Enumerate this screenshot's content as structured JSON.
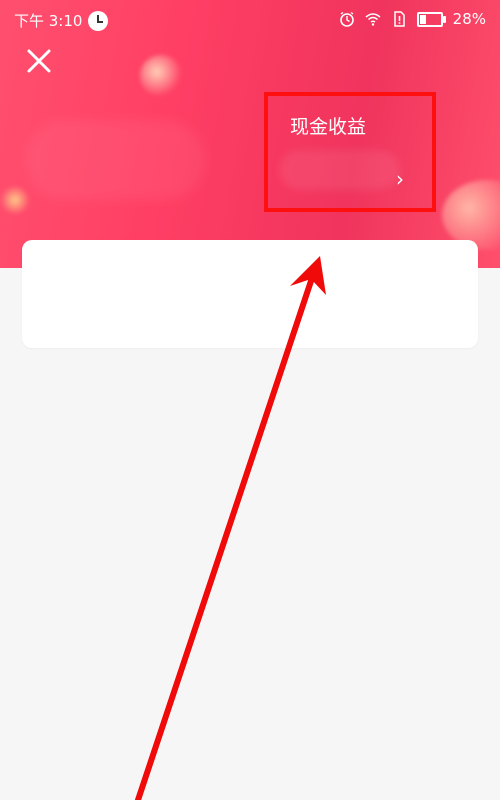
{
  "status_bar": {
    "time": "下午 3:10",
    "battery_percent": "28%",
    "battery_level": 0.28
  },
  "header": {
    "close_icon": "close-icon"
  },
  "earnings": {
    "label": "现金收益",
    "chevron": "›"
  },
  "colors": {
    "hero_gradient_start": "#ff4f6f",
    "hero_gradient_end": "#f0345d",
    "highlight": "#ff1010",
    "background": "#f6f6f6"
  },
  "icons": [
    "clock-icon",
    "alarm-icon",
    "wifi-icon",
    "sim-alert-icon",
    "battery-icon",
    "close-icon",
    "chevron-right-icon",
    "annotation-arrow-icon"
  ]
}
